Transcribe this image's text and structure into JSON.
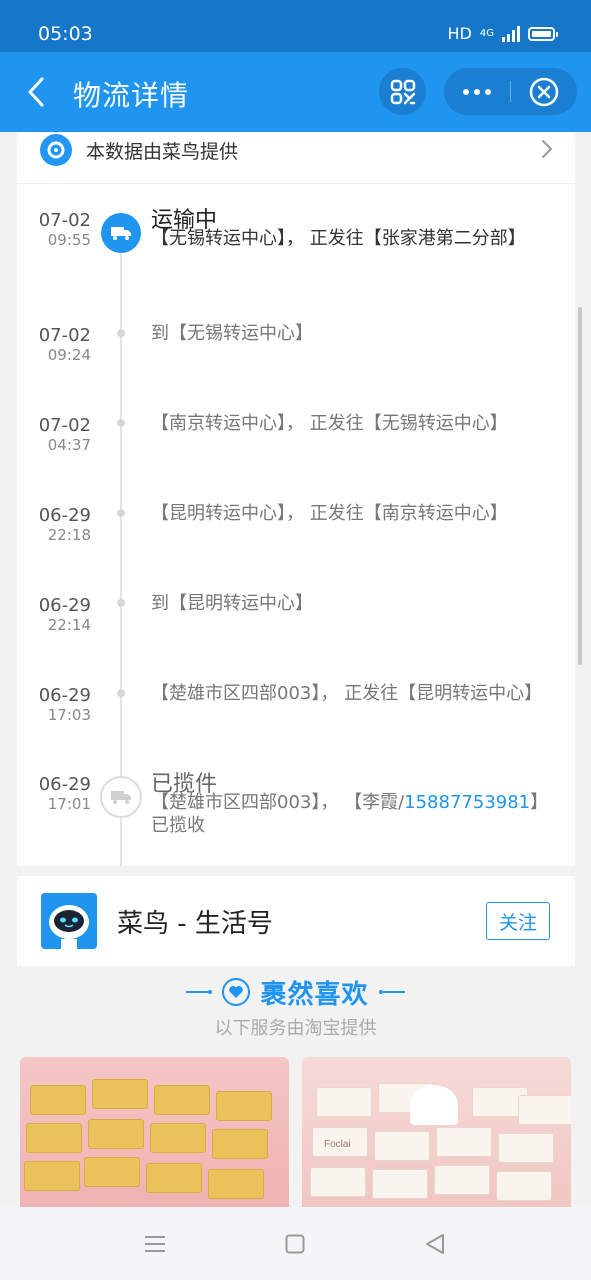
{
  "status_bar": {
    "time": "05:03",
    "hd": "HD",
    "network": "4G"
  },
  "nav": {
    "title": "物流详情"
  },
  "provider": {
    "text": "本数据由菜鸟提供"
  },
  "timeline": [
    {
      "date": "07-02",
      "time": "09:55",
      "status": "运输中",
      "desc": "【无锡转运中心】， 正发往【张家港第二分部】",
      "kind": "active"
    },
    {
      "date": "07-02",
      "time": "09:24",
      "desc": "到【无锡转运中心】",
      "kind": "dot"
    },
    {
      "date": "07-02",
      "time": "04:37",
      "desc": "【南京转运中心】， 正发往【无锡转运中心】",
      "kind": "dot"
    },
    {
      "date": "06-29",
      "time": "22:18",
      "desc": "【昆明转运中心】， 正发往【南京转运中心】",
      "kind": "dot"
    },
    {
      "date": "06-29",
      "time": "22:14",
      "desc": "到【昆明转运中心】",
      "kind": "dot"
    },
    {
      "date": "06-29",
      "time": "17:03",
      "desc": "【楚雄市区四部003】， 正发往【昆明转运中心】",
      "kind": "dot"
    },
    {
      "date": "06-29",
      "time": "17:01",
      "status": "已揽件",
      "desc_before": "【楚雄市区四部003】， 【李霞/",
      "phone": "15887753981",
      "desc_after": "】已揽收",
      "kind": "idle"
    }
  ],
  "life_account": {
    "name": "菜鸟 - 生活号",
    "follow_label": "关注"
  },
  "recommend": {
    "title": "裹然喜欢",
    "subtitle": "以下服务由淘宝提供"
  },
  "products": [
    {
      "brand": "",
      "color": "#e9c25c"
    },
    {
      "brand": "Foclai",
      "color": "#faf4ef"
    }
  ],
  "colors": {
    "primary": "#1f95ef",
    "status_bar": "#1677c9"
  }
}
